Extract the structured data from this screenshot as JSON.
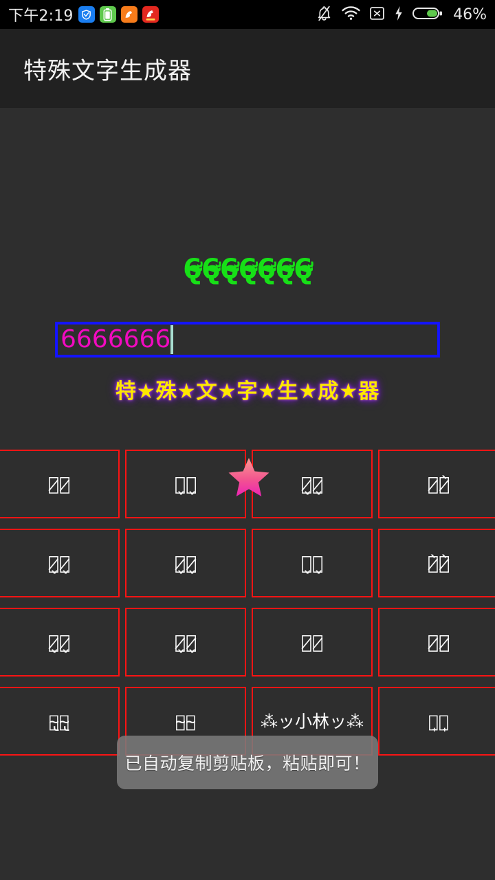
{
  "statusbar": {
    "clock": "下午2:19",
    "battery_percent": "46%",
    "app_icons": [
      {
        "name": "tencent-security-icon",
        "glyph": "▽"
      },
      {
        "name": "battery-saver-icon",
        "glyph": "▮"
      },
      {
        "name": "uc-browser-icon",
        "glyph": "U"
      },
      {
        "name": "uc-browser-red-icon",
        "glyph": "U"
      }
    ],
    "right_icons": [
      {
        "name": "bell-muted-icon"
      },
      {
        "name": "wifi-icon"
      },
      {
        "name": "sim-off-icon"
      },
      {
        "name": "charging-bolt-icon"
      },
      {
        "name": "battery-icon"
      }
    ]
  },
  "titlebar": {
    "title": "特殊文字生成器"
  },
  "preview": {
    "green_text": "6̴̢̛6̴̢̛6̴̢̛6̴̢̛6̴̢̛6̴̢̛6̴̢̛"
  },
  "input": {
    "value": "6666666",
    "placeholder": "",
    "border_color": "#1414ff",
    "text_color": "#f20ac0",
    "caret_color": "#a8ddd0"
  },
  "subtitle": {
    "starred_title": "特★殊★文★字★生★成★器",
    "color": "#ffe800",
    "glow_color": "#8a2be2"
  },
  "grid": {
    "border_color": "#fa1414",
    "rows": [
      [
        {
          "label": "小̷林̷",
          "size": "normal"
        },
        {
          "label": "小̬林̬",
          "size": "normal"
        },
        {
          "label": "小̷̬林̷̬",
          "size": "normal"
        },
        {
          "label": "小̷林̷̀",
          "size": "normal"
        }
      ],
      [
        {
          "label": "小̷̬林̷̬",
          "size": "normal"
        },
        {
          "label": "小̷̬林̷̬",
          "size": "normal"
        },
        {
          "label": "小̬林̬",
          "size": "normal"
        },
        {
          "label": "小̷̀林̷̀",
          "size": "normal"
        }
      ],
      [
        {
          "label": "小̷̬林̷̬",
          "size": "normal"
        },
        {
          "label": "小̷̬林̷̬",
          "size": "normal"
        },
        {
          "label": "小̷林̷",
          "size": "normal"
        },
        {
          "label": "小̷林̷",
          "size": "normal"
        }
      ],
      [
        {
          "label": "小̴̢林̴̢",
          "size": "sm"
        },
        {
          "label": "小̴̴林̴̴",
          "size": "sm"
        },
        {
          "label": "⁂ッ小林ッ⁂",
          "size": "sm"
        },
        {
          "label": "小̟林̟",
          "size": "sm"
        }
      ]
    ]
  },
  "star_overlay": {
    "name": "pink-star-icon",
    "color_top": "#f98c8c",
    "color_bottom": "#ed2bb0"
  },
  "toast": {
    "message": "已自动复制剪贴板，粘贴即可！"
  }
}
